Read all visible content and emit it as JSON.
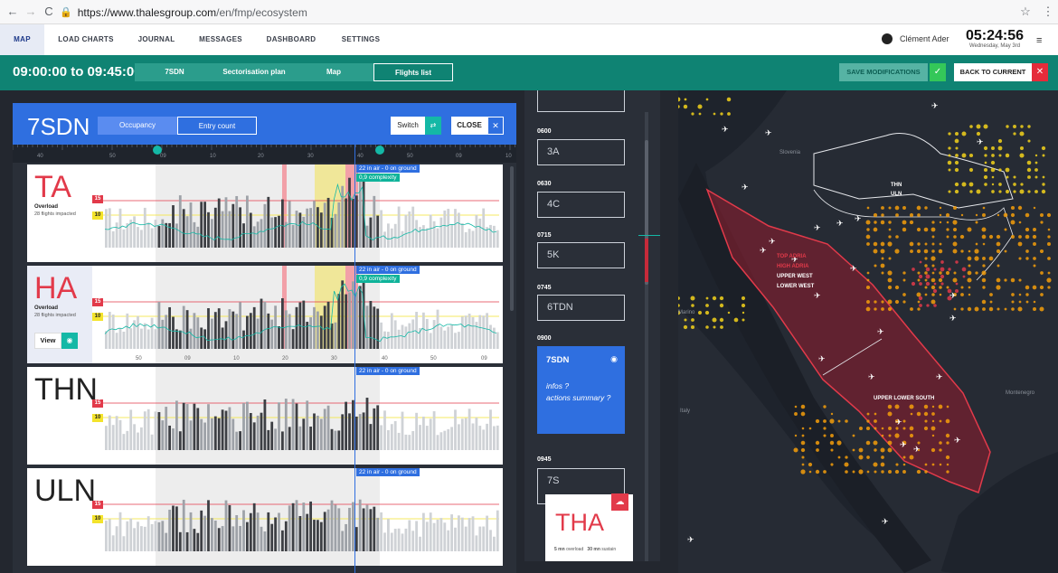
{
  "browser": {
    "url_host": "https://www.thalesgroup.com",
    "url_path": "/en/fmp/ecosystem",
    "back_glyph": "←",
    "forward_glyph": "→",
    "reload_glyph": "C",
    "star_glyph": "☆",
    "menu_glyph": "⋮"
  },
  "topnav": {
    "tabs": [
      "MAP",
      "LOAD CHARTS",
      "JOURNAL",
      "MESSAGES",
      "DASHBOARD",
      "SETTINGS"
    ],
    "active": "MAP",
    "user": "Clément Ader",
    "time": "05:24:56",
    "date": "Wednesday, May 3rd"
  },
  "toolbar": {
    "time_range": "09:00:00 to 09:45:00",
    "views": [
      "7SDN",
      "Sectorisation plan",
      "Map",
      "Flights list"
    ],
    "active_view": "Flights list",
    "save_label": "SAVE MODIFICATIONS",
    "back_label": "BACK TO CURRENT",
    "save_glyph": "✓",
    "back_close_glyph": "✕"
  },
  "sector_panel": {
    "title": "7SDN",
    "segments": [
      "Occupancy",
      "Entry count"
    ],
    "switch_label": "Switch",
    "close_label": "CLOSE",
    "close_glyph": "✕",
    "switch_glyph": "⇄",
    "ruler_labels": [
      "40",
      "50",
      "09",
      "10",
      "20",
      "30",
      "40",
      "50",
      "09",
      "10"
    ],
    "cards": [
      {
        "name": "TA",
        "status": "Overload",
        "impacted": "28 flights impacted",
        "air": "22 in air - 0 on ground",
        "complexity": "0,9 complexity",
        "name_color": "#e23a4a",
        "threshold_high": "15",
        "threshold_low": "10"
      },
      {
        "name": "HA",
        "status": "Overload",
        "impacted": "28 flights impacted",
        "air": "22 in air - 0 on ground",
        "complexity": "0,9 complexity",
        "name_color": "#e23a4a",
        "view_label": "View",
        "threshold_high": "15",
        "threshold_low": "10",
        "axis_labels": [
          "50",
          "09",
          "10",
          "20",
          "30",
          "40",
          "50",
          "09"
        ]
      },
      {
        "name": "THN",
        "air": "22 in air - 0 on ground",
        "name_color": "#222222",
        "threshold_high": "15",
        "threshold_low": "10"
      },
      {
        "name": "ULN",
        "air": "22 in air - 0 on ground",
        "name_color": "#222222",
        "threshold_high": "15",
        "threshold_low": "10"
      }
    ]
  },
  "timeline": {
    "slots": [
      {
        "time": "0600",
        "value": "3A"
      },
      {
        "time": "0630",
        "value": "4C"
      },
      {
        "time": "0715",
        "value": "5K"
      },
      {
        "time": "0745",
        "value": "6TDN"
      }
    ],
    "selected": {
      "time": "0900",
      "name": "7SDN",
      "info_1": "infos ?",
      "info_2": "actions summary ?",
      "eye_glyph": "◉"
    },
    "next": {
      "time": "0945",
      "value": "7S"
    },
    "popup": {
      "name": "THA",
      "overload_val": "5 mn",
      "overload_lbl": "overload",
      "sustain_val": "30 mn",
      "sustain_lbl": "sustain",
      "cloud_glyph": "☁"
    }
  },
  "map": {
    "labels": {
      "slovenia": "Slovenia",
      "italy": "Italy",
      "marino": "Marino",
      "montenegro": "Montenegro",
      "thn": "THN",
      "uln": "ULN",
      "top_adria": "TOP ADRIA",
      "high_adria": "HIGH ADRIA",
      "upper_west": "UPPER WEST",
      "lower_west": "LOWER WEST",
      "upper_lower_south": "UPPER LOWER SOUTH"
    }
  }
}
